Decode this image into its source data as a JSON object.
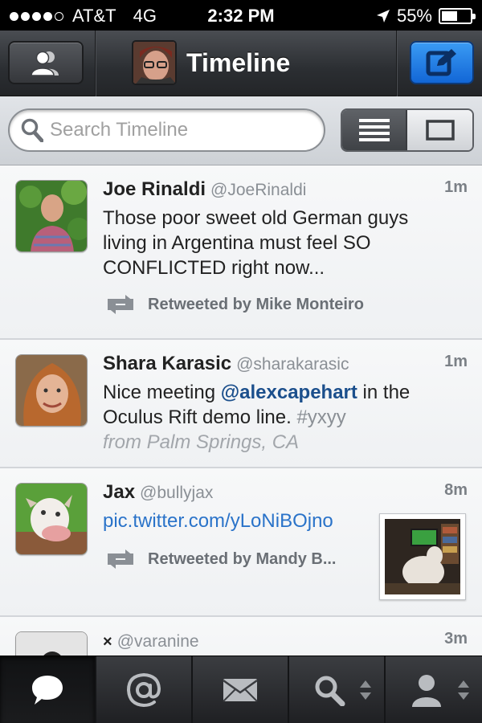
{
  "status": {
    "carrier": "AT&T",
    "network": "4G",
    "time": "2:32 PM",
    "battery": "55%",
    "battery_level": 0.55,
    "signal_bars_filled": 4,
    "signal_bars_total": 5
  },
  "nav": {
    "title": "Timeline",
    "accounts_icon": "people-icon",
    "compose_icon": "compose-icon",
    "compose_color": "#1f7ee6"
  },
  "search": {
    "placeholder": "Search Timeline",
    "value": ""
  },
  "tweets": [
    {
      "name": "Joe Rinaldi",
      "handle": "@JoeRinaldi",
      "time": "1m",
      "text": "Those poor sweet old German guys living in Argentina must feel SO CONFLICTED right now...",
      "retweeted_by": "Retweeted by Mike Monteiro"
    },
    {
      "name": "Shara Karasic",
      "handle": "@sharakarasic",
      "time": "1m",
      "text_before": "Nice meeting ",
      "mention": "@alexcapehart",
      "text_after": " in the Oculus Rift demo line. ",
      "hashtag": "#yxyy",
      "place": "from Palm Springs, CA"
    },
    {
      "name": "Jax",
      "handle": "@bullyjax",
      "time": "8m",
      "link": "pic.twitter.com/yLoNiBOjno",
      "retweeted_by": "Retweeted by Mandy B..."
    },
    {
      "name": "×",
      "handle": "@varanine",
      "time": "3m"
    }
  ],
  "tabs": [
    {
      "icon": "speech-bubble-icon",
      "active": true
    },
    {
      "icon": "at-icon",
      "active": false
    },
    {
      "icon": "envelope-icon",
      "active": false
    },
    {
      "icon": "search-icon",
      "active": false
    },
    {
      "icon": "profile-icon",
      "active": false
    }
  ]
}
